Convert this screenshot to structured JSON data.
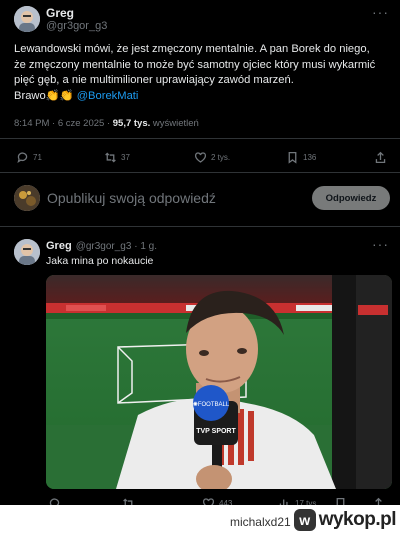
{
  "tweet": {
    "author_name": "Greg",
    "author_handle": "@gr3gor_g3",
    "line1": "Lewandowski mówi, że jest zmęczony mentalnie. A pan Borek do niego,",
    "line2": "że zmęczony mentalnie to może być samotny ojciec który musi wykarmić",
    "line3": "pięć gęb, a nie multimilioner uprawiający zawód marzeń.",
    "line4_prefix": "Brawo👏👏 ",
    "mention": "@BorekMati",
    "time": "8:14 PM · 6 cze 2025 · ",
    "views_value": "95,7 tys.",
    "views_label": " wyświetleń",
    "stats": {
      "replies": "71",
      "retweets": "37",
      "likes": "2 tys.",
      "bookmarks": "136"
    }
  },
  "composer": {
    "placeholder": "Opublikuj swoją odpowiedź",
    "button": "Odpowiedz"
  },
  "reply": {
    "author_name": "Greg",
    "author_handle": "@gr3gor_g3 · 1 g.",
    "text": "Jaka mina po nokaucie",
    "stats": {
      "replies": "",
      "retweets": "",
      "likes": "443",
      "views": "17 tys."
    },
    "media_brand": "TVP SPORT",
    "media_ticker": "✺FOOTBALL"
  },
  "footer": {
    "credit": "michalxd21  z",
    "logo_badge": "w",
    "logo_text": "wykop.pl"
  },
  "colors": {
    "background": "#000000",
    "text": "#e7e9ea",
    "muted": "#71767b",
    "accent": "#1d9bf0"
  }
}
